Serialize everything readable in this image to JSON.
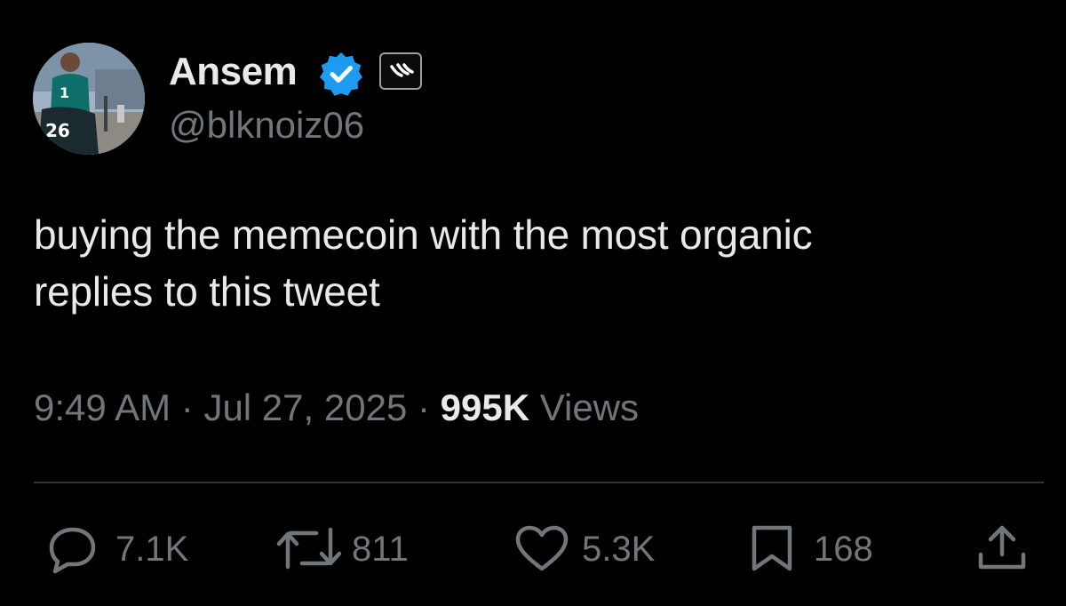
{
  "author": {
    "name": "Ansem",
    "handle": "@blknoiz06",
    "avatar_jersey_number": "26",
    "verified_color": "#1d9bf0"
  },
  "tweet": {
    "text_lines": [
      "buying the memecoin with the most organic",
      "replies to this tweet"
    ],
    "time": "9:49 AM",
    "date": "Jul 27, 2025",
    "separator": "·",
    "views_count": "995K",
    "views_label": "Views"
  },
  "actions": {
    "replies": "7.1K",
    "reposts": "811",
    "likes": "5.3K",
    "bookmarks": "168"
  },
  "icons": [
    "verified-badge-icon",
    "affiliate-badge-icon",
    "reply-icon",
    "repost-icon",
    "like-icon",
    "bookmark-icon",
    "share-icon"
  ],
  "colors": {
    "background": "#000000",
    "primary_text": "#e7e9ea",
    "secondary_text": "#71767b",
    "divider": "#2f3336",
    "accent": "#1d9bf0"
  }
}
